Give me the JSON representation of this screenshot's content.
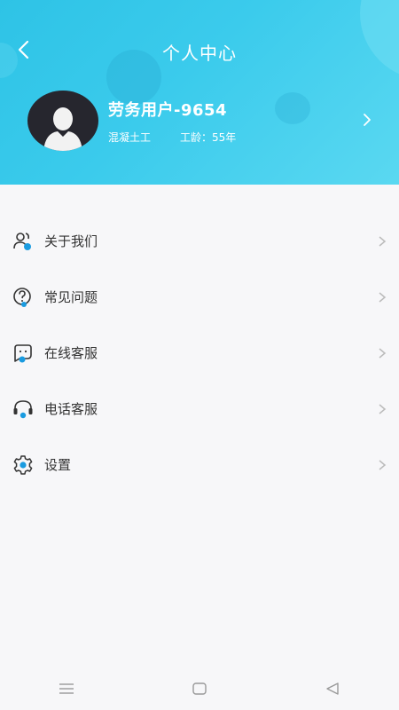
{
  "header": {
    "title": "个人中心",
    "back_icon": "back-arrow-icon"
  },
  "profile": {
    "name": "劳务用户-9654",
    "job": "混凝土工",
    "age_text": "工龄：55年",
    "avatar_icon": "user-avatar-icon"
  },
  "menu": {
    "items": [
      {
        "label": "关于我们",
        "icon": "users-icon"
      },
      {
        "label": "常见问题",
        "icon": "question-icon"
      },
      {
        "label": "在线客服",
        "icon": "chat-face-icon"
      },
      {
        "label": "电话客服",
        "icon": "headset-icon"
      },
      {
        "label": "设置",
        "icon": "gear-icon"
      }
    ]
  },
  "colors": {
    "header_start": "#2ec3e6",
    "header_end": "#5ad8f1",
    "icon_accent": "#1a9be0",
    "text": "#333333",
    "chevron": "#bbbbbb"
  }
}
